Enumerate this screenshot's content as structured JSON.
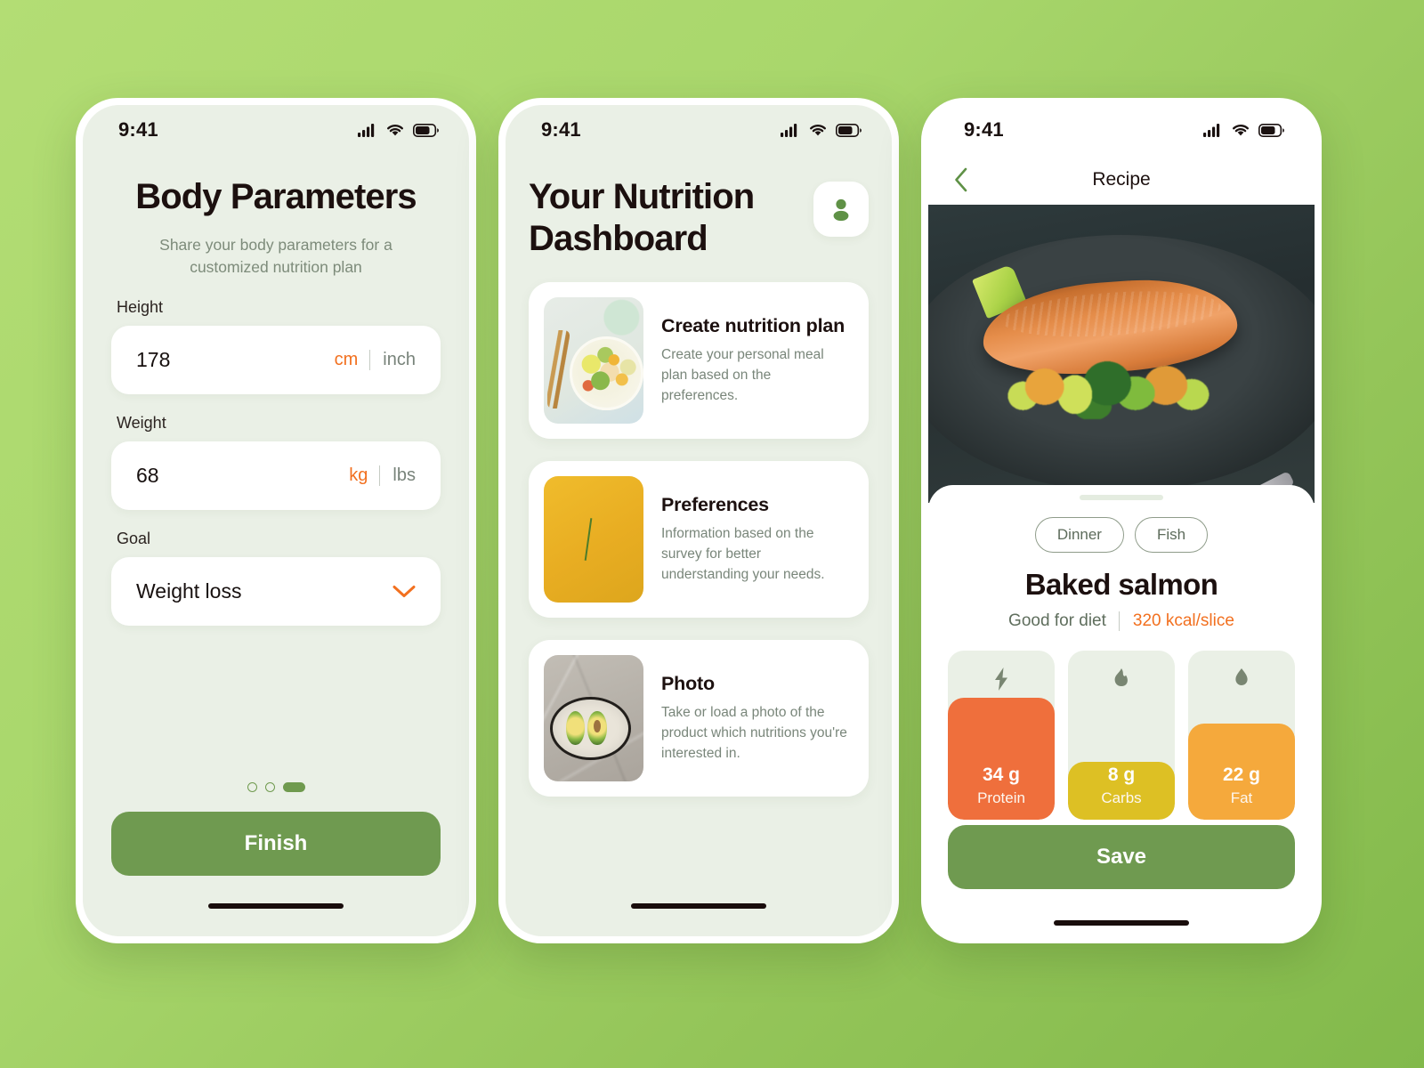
{
  "status_bar": {
    "time": "9:41",
    "icons": [
      "cellular-signal-icon",
      "wifi-icon",
      "battery-icon"
    ]
  },
  "screen1": {
    "name": "body-parameters",
    "title": "Body Parameters",
    "subtitle": "Share your body parameters for a customized nutrition plan",
    "fields": [
      {
        "label": "Height",
        "value": "178",
        "unit_selected": "cm",
        "unit_other": "inch"
      },
      {
        "label": "Weight",
        "value": "68",
        "unit_selected": "kg",
        "unit_other": "lbs"
      }
    ],
    "goal": {
      "label": "Goal",
      "value": "Weight loss",
      "icon": "chevron-down-icon"
    },
    "pagination": {
      "total": 3,
      "active_index": 2
    },
    "cta_label": "Finish"
  },
  "screen2": {
    "name": "nutrition-dashboard",
    "title": "Your Nutrition Dashboard",
    "avatar_icon": "person-icon",
    "cards": [
      {
        "title": "Create nutrition plan",
        "desc": "Create your personal meal plan based on the preferences.",
        "thumb": "salad-plate-photo"
      },
      {
        "title": "Preferences",
        "desc": "Information based on the survey for better understanding your needs.",
        "thumb": "vegetables-yellow-photo"
      },
      {
        "title": "Photo",
        "desc": "Take or load a photo of the product which nutritions you're interested in.",
        "thumb": "avocado-plate-photo"
      }
    ]
  },
  "screen3": {
    "name": "recipe-detail",
    "nav_title": "Recipe",
    "back_icon": "chevron-left-icon",
    "hero_image": "baked-salmon-photo",
    "tags": [
      "Dinner",
      "Fish"
    ],
    "recipe_title": "Baked salmon",
    "meta_left": "Good for diet",
    "meta_right": "320 kcal/slice",
    "macros": [
      {
        "icon": "bolt-icon",
        "value": "34 g",
        "name": "Protein",
        "fill_percent": 72,
        "color": "#ef6f3c"
      },
      {
        "icon": "flame-icon",
        "value": "8 g",
        "name": "Carbs",
        "fill_percent": 34,
        "color": "#ddc024"
      },
      {
        "icon": "droplet-icon",
        "value": "22 g",
        "name": "Fat",
        "fill_percent": 57,
        "color": "#f5a93c"
      }
    ],
    "cta_label": "Save"
  },
  "colors": {
    "background_top": "#b3dd74",
    "background_bottom": "#82b94b",
    "screen_mint": "#eaf0e6",
    "accent_orange": "#f2701f",
    "accent_green": "#6f9a50",
    "text_dark": "#1c100f",
    "text_muted": "#7d8b7a"
  }
}
